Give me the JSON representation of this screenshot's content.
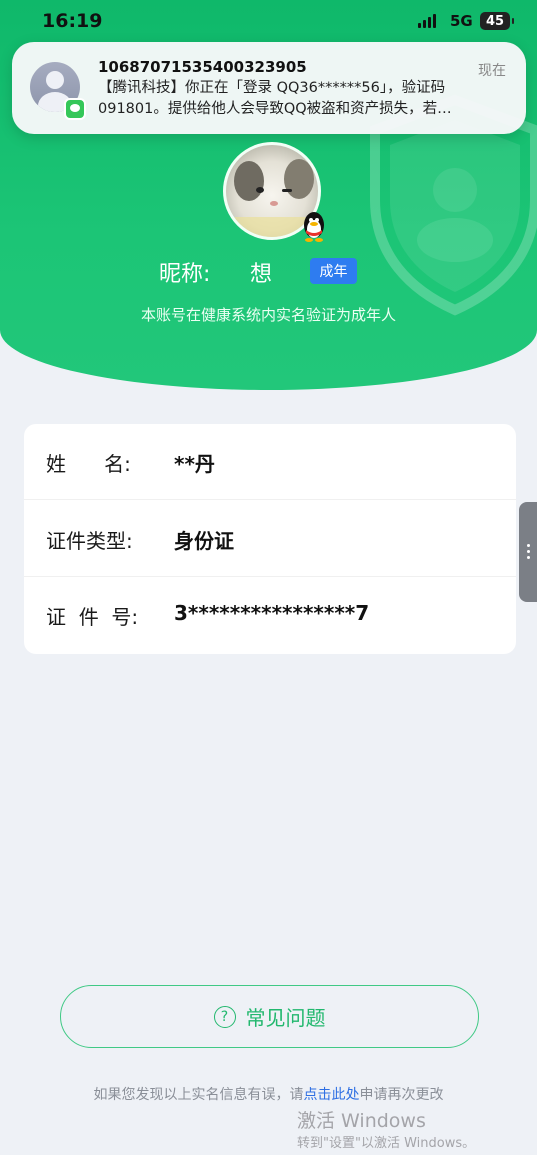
{
  "status_bar": {
    "time": "16:19",
    "network": "5G",
    "battery": "45"
  },
  "notification": {
    "sender": "10687071535400323905",
    "time": "现在",
    "line1": "【腾讯科技】你正在「登录 QQ36******56」，验证码",
    "line2": "091801。提供给他人会导致QQ被盗和资产损失，若…"
  },
  "profile": {
    "nick_label": "昵称:",
    "nick_value": "想",
    "adult_badge": "成年",
    "verify_note": "本账号在健康系统内实名验证为成年人"
  },
  "info": {
    "rows": [
      {
        "label": "姓      名:",
        "value": "**丹"
      },
      {
        "label": "证件类型:",
        "value": "身份证"
      },
      {
        "label": "证  件  号:",
        "value": "3****************7"
      }
    ]
  },
  "faq": {
    "label": "常见问题"
  },
  "footer": {
    "text_before": "如果您发现以上实名信息有误，请",
    "link": "点击此处",
    "text_after": "申请再次更改"
  },
  "watermark": {
    "title": "激活 Windows",
    "subtitle": "转到\"设置\"以激活 Windows。"
  },
  "colors": {
    "brand_green": "#1cc576",
    "badge_blue": "#2e7cf0",
    "link_blue": "#2e6fe3"
  }
}
